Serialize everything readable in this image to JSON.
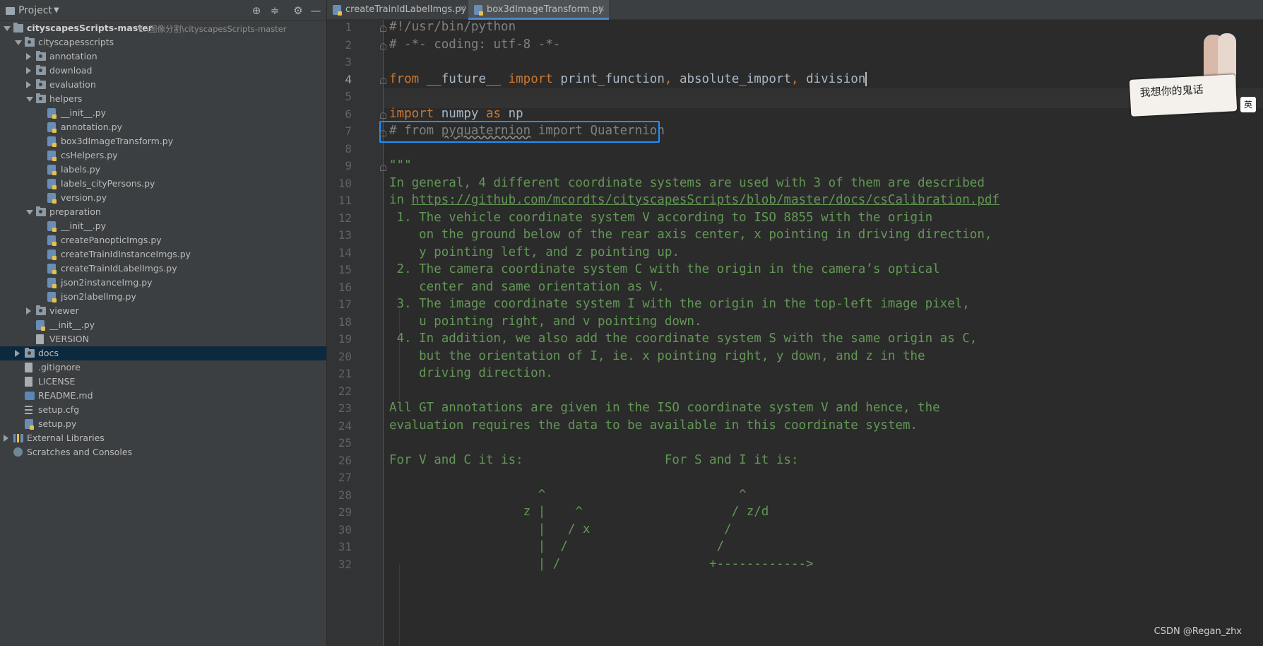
{
  "project_panel": {
    "title": "Project",
    "root_name": "cityscapesScripts-master",
    "root_path": "E:\\图像分割\\cityscapesScripts-master",
    "tree": [
      {
        "label": "cityscapesscripts",
        "type": "folder",
        "depth": 1,
        "expanded": true
      },
      {
        "label": "annotation",
        "type": "folder",
        "depth": 2,
        "expanded": false
      },
      {
        "label": "download",
        "type": "folder",
        "depth": 2,
        "expanded": false
      },
      {
        "label": "evaluation",
        "type": "folder",
        "depth": 2,
        "expanded": false
      },
      {
        "label": "helpers",
        "type": "folder",
        "depth": 2,
        "expanded": true
      },
      {
        "label": "__init__.py",
        "type": "py",
        "depth": 3
      },
      {
        "label": "annotation.py",
        "type": "py",
        "depth": 3
      },
      {
        "label": "box3dImageTransform.py",
        "type": "py",
        "depth": 3
      },
      {
        "label": "csHelpers.py",
        "type": "py",
        "depth": 3
      },
      {
        "label": "labels.py",
        "type": "py",
        "depth": 3
      },
      {
        "label": "labels_cityPersons.py",
        "type": "py",
        "depth": 3
      },
      {
        "label": "version.py",
        "type": "py",
        "depth": 3
      },
      {
        "label": "preparation",
        "type": "folder",
        "depth": 2,
        "expanded": true
      },
      {
        "label": "__init__.py",
        "type": "py",
        "depth": 3
      },
      {
        "label": "createPanopticImgs.py",
        "type": "py",
        "depth": 3
      },
      {
        "label": "createTrainIdInstanceImgs.py",
        "type": "py",
        "depth": 3
      },
      {
        "label": "createTrainIdLabelImgs.py",
        "type": "py",
        "depth": 3
      },
      {
        "label": "json2instanceImg.py",
        "type": "py",
        "depth": 3
      },
      {
        "label": "json2labelImg.py",
        "type": "py",
        "depth": 3
      },
      {
        "label": "viewer",
        "type": "folder",
        "depth": 2,
        "expanded": false
      },
      {
        "label": "__init__.py",
        "type": "py",
        "depth": 2
      },
      {
        "label": "VERSION",
        "type": "txt",
        "depth": 2
      },
      {
        "label": "docs",
        "type": "folder",
        "depth": 1,
        "expanded": false,
        "selected": true
      },
      {
        "label": ".gitignore",
        "type": "txt",
        "depth": 1
      },
      {
        "label": "LICENSE",
        "type": "txt",
        "depth": 1
      },
      {
        "label": "README.md",
        "type": "md",
        "depth": 1
      },
      {
        "label": "setup.cfg",
        "type": "cfg",
        "depth": 1
      },
      {
        "label": "setup.py",
        "type": "py",
        "depth": 1
      },
      {
        "label": "External Libraries",
        "type": "lib",
        "depth": 0,
        "expanded": false
      },
      {
        "label": "Scratches and Consoles",
        "type": "scratch",
        "depth": 0
      }
    ]
  },
  "tabs": [
    {
      "label": "createTrainIdLabelImgs.py",
      "active": false
    },
    {
      "label": "box3dImageTransform.py",
      "active": true
    }
  ],
  "editor": {
    "line_numbers": [
      "1",
      "2",
      "3",
      "4",
      "5",
      "6",
      "7",
      "8",
      "9",
      "10",
      "11",
      "12",
      "13",
      "14",
      "15",
      "16",
      "17",
      "18",
      "19",
      "20",
      "21",
      "22",
      "23",
      "24",
      "25",
      "26",
      "27",
      "28",
      "29",
      "30",
      "31",
      "32"
    ],
    "lines": {
      "l1": "#!/usr/bin/python",
      "l2": "# -*- coding: utf-8 -*-",
      "l4_kw1": "from",
      "l4_mod": " __future__ ",
      "l4_kw2": "import",
      "l4_a": " print_function",
      "l4_c1": ",",
      "l4_b": " absolute_import",
      "l4_c2": ",",
      "l4_c": " division",
      "l6_kw1": "import",
      "l6_mod": " numpy ",
      "l6_kw2": "as",
      "l6_alias": " np",
      "l7_a": "# from ",
      "l7_b": "pyquaternion",
      "l7_c": " import Quaternion",
      "l9": "\"\"\"",
      "l10": "In general, 4 different coordinate systems are used with 3 of them are described",
      "l11_a": "in ",
      "l11_url": "https://github.com/mcordts/cityscapesScripts/blob/master/docs/csCalibration.pdf",
      "l12": " 1. The vehicle coordinate system V according to ISO 8855 with the origin",
      "l13": "    on the ground below of the rear axis center, x pointing in driving direction,",
      "l14": "    y pointing left, and z pointing up.",
      "l15": " 2. The camera coordinate system C with the origin in the camera’s optical",
      "l16": "    center and same orientation as V.",
      "l17": " 3. The image coordinate system I with the origin in the top-left image pixel,",
      "l18": "    u pointing right, and v pointing down.",
      "l19": " 4. In addition, we also add the coordinate system S with the same origin as C,",
      "l20": "    but the orientation of I, ie. x pointing right, y down, and z in the",
      "l21": "    driving direction.",
      "l23": "All GT annotations are given in the ISO coordinate system V and hence, the",
      "l24": "evaluation requires the data to be available in this coordinate system.",
      "l26": "For V and C it is:                   For S and I it is:",
      "l28": "                    ^                          ^",
      "l29": "                  z |    ^                    / z/d",
      "l30": "                    |   / x                  /",
      "l31": "                    |  /                    /",
      "l32": "                    | /                    +------------>"
    }
  },
  "overlay": {
    "sticker_text": "我想你的鬼话",
    "sticker_badge": "英",
    "watermark": "CSDN @Regan_zhx"
  }
}
